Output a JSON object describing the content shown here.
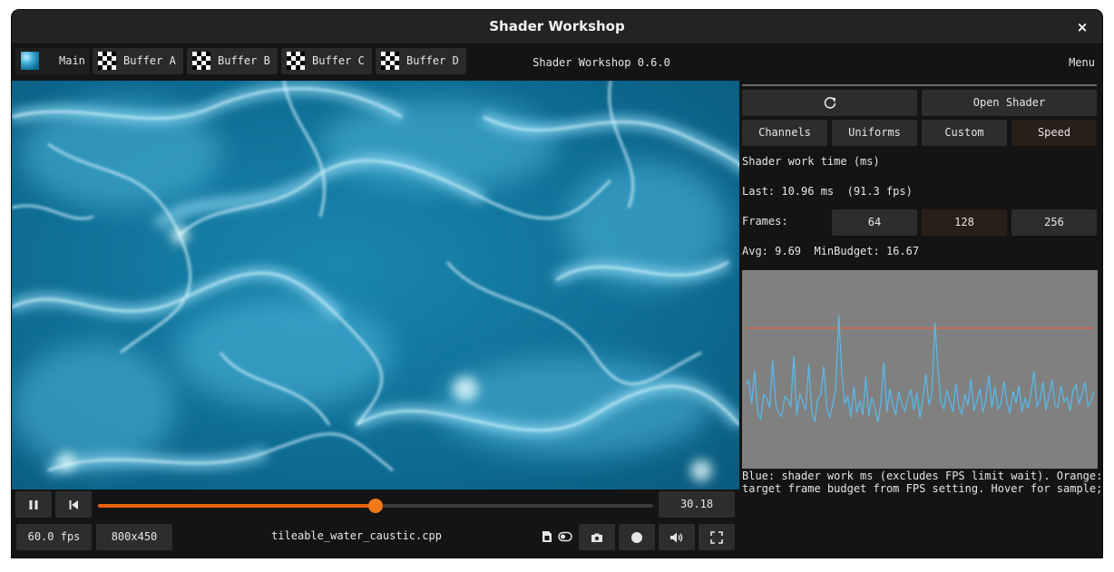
{
  "window": {
    "title": "Shader Workshop",
    "close_glyph": "×"
  },
  "tabs": [
    {
      "label": "Main",
      "icon": "water-thumbnail"
    },
    {
      "label": "Buffer A",
      "icon": "checker-thumbnail"
    },
    {
      "label": "Buffer B",
      "icon": "checker-thumbnail"
    },
    {
      "label": "Buffer C",
      "icon": "checker-thumbnail"
    },
    {
      "label": "Buffer D",
      "icon": "checker-thumbnail"
    }
  ],
  "header": {
    "version": "Shader Workshop 0.6.0",
    "menu_label": "Menu"
  },
  "side": {
    "reload_icon": "refresh-icon",
    "open_shader": "Open Shader",
    "panel_tabs": [
      "Channels",
      "Uniforms",
      "Custom",
      "Speed"
    ],
    "selected_panel_tab": "Speed",
    "heading": "Shader work time (ms)",
    "last_line": "Last: 10.96 ms  (91.3 fps)",
    "frames_label": "Frames:",
    "frame_options": [
      "64",
      "128",
      "256"
    ],
    "selected_frames": "128",
    "avg_line": "Avg: 9.69  MinBudget: 16.67",
    "graph_note_line1": "Blue: shader work ms (excludes FPS limit wait). Orange:",
    "graph_note_line2": "target frame budget from FPS setting. Hover for sample;",
    "colors": {
      "work_line": "#5ab8e6",
      "budget_line": "#e06a4a",
      "graph_bg": "#808080"
    },
    "graph": {
      "budget_ms": 16.67,
      "y_range_ms": [
        0,
        23
      ],
      "samples_ms": [
        9.6,
        10.1,
        7.2,
        11.4,
        6.1,
        5.3,
        8.4,
        7.9,
        6.7,
        12.6,
        7.1,
        6.0,
        5.6,
        8.1,
        7.7,
        6.9,
        13.2,
        5.8,
        8.5,
        7.4,
        6.4,
        12.1,
        6.2,
        4.9,
        7.8,
        8.3,
        11.9,
        6.6,
        5.5,
        7.1,
        9.2,
        18.3,
        11.1,
        7.2,
        8.2,
        5.5,
        9.4,
        6.1,
        7.6,
        5.8,
        10.6,
        5.7,
        8.0,
        6.8,
        4.9,
        7.3,
        12.4,
        6.1,
        9.1,
        7.0,
        5.8,
        8.7,
        7.2,
        6.3,
        7.9,
        9.0,
        6.4,
        8.6,
        5.4,
        7.7,
        10.9,
        7.1,
        8.3,
        17.3,
        11.8,
        7.4,
        6.6,
        8.9,
        7.5,
        6.2,
        9.7,
        6.9,
        5.9,
        8.4,
        7.0,
        10.3,
        6.3,
        7.6,
        9.1,
        6.1,
        7.8,
        10.8,
        6.7,
        9.3,
        6.5,
        7.2,
        10.0,
        7.4,
        6.0,
        8.8,
        7.3,
        9.5,
        6.2,
        7.9,
        6.6,
        8.5,
        11.3,
        6.9,
        7.7,
        9.9,
        6.4,
        8.1,
        10.2,
        7.0,
        6.8,
        9.4,
        7.5,
        8.0,
        6.3,
        8.9,
        9.6,
        7.2,
        8.4,
        9.9,
        6.9,
        7.6,
        8.8
      ]
    }
  },
  "controls": {
    "pause_icon": "pause-icon",
    "restart_icon": "skip-to-start-icon",
    "progress": 0.5,
    "time_value": "30.18",
    "fps": "60.0 fps",
    "resolution": "800x450",
    "filename": "tileable_water_caustic.cpp",
    "accent": "#e8620c",
    "icons": [
      "file-icon",
      "toggle-icon",
      "camera-icon",
      "record-icon",
      "volume-icon",
      "fullscreen-icon"
    ]
  }
}
